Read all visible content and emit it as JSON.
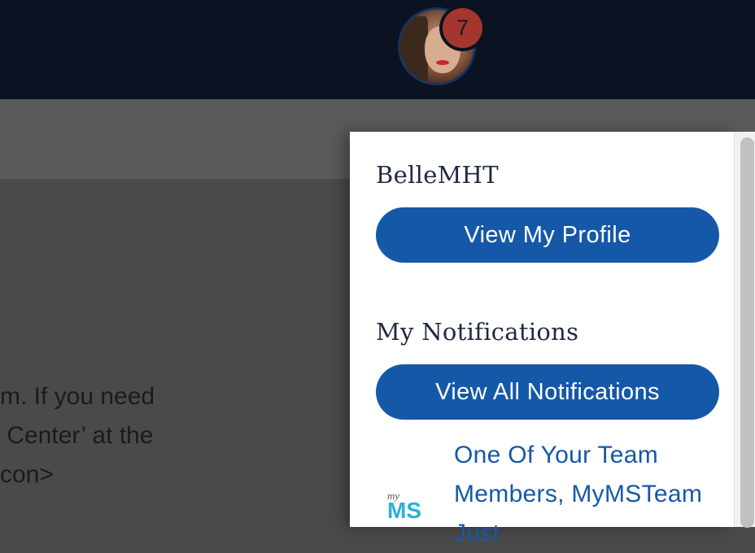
{
  "header": {
    "notification_count": "7"
  },
  "background_text": {
    "lines": [
      "m. If you need",
      " Center’ at the",
      "con>"
    ]
  },
  "panel": {
    "username": "BelleMHT",
    "view_profile_label": "View My Profile",
    "notifications_heading": "My Notifications",
    "view_all_label": "View All Notifications",
    "notifications": [
      {
        "text": "One Of Your Team Members, MyMSTeam Just",
        "logo_text_small": "my",
        "logo_text_large": "MS"
      }
    ]
  },
  "colors": {
    "topbar": "#0b1221",
    "primary_button": "#1558a8",
    "badge": "#a4362f",
    "link": "#1558a8"
  },
  "icons": {
    "avatar": "user-avatar",
    "badge": "notification-count-badge"
  }
}
